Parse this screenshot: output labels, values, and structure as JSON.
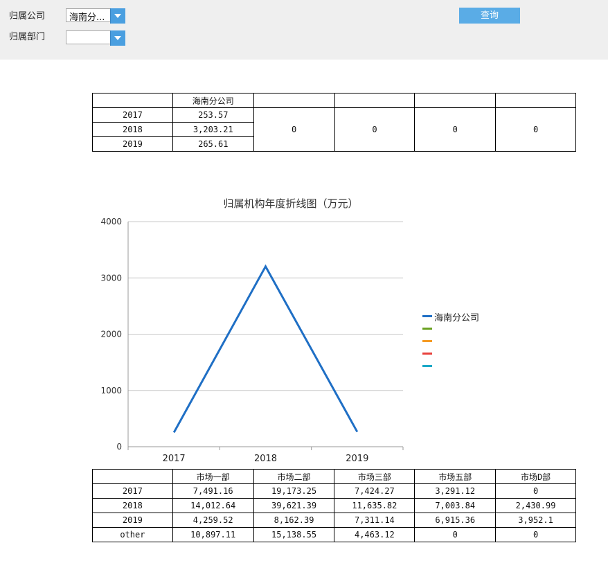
{
  "filters": {
    "company_label": "归属公司",
    "company_value": "海南分...",
    "dept_label": "归属部门",
    "dept_value": "",
    "query_label": "查询"
  },
  "top_table": {
    "headers": [
      "",
      "海南分公司",
      "",
      "",
      "",
      ""
    ],
    "rows": [
      {
        "year": "2017",
        "value": "253.57"
      },
      {
        "year": "2018",
        "value": "3,203.21"
      },
      {
        "year": "2019",
        "value": "265.61"
      }
    ],
    "merged_values": [
      "0",
      "0",
      "0",
      "0"
    ]
  },
  "chart_data": {
    "type": "line",
    "title": "归属机构年度折线图（万元）",
    "categories": [
      "2017",
      "2018",
      "2019"
    ],
    "ylim": [
      0,
      4000
    ],
    "yticks": [
      "0",
      "1000",
      "2000",
      "3000",
      "4000"
    ],
    "grid": true,
    "legend_position": "right",
    "series": [
      {
        "name": "海南分公司",
        "values": [
          253.57,
          3203.21,
          265.61
        ],
        "color": "#1f6fc5"
      },
      {
        "name": "",
        "values": [],
        "color": "#6aa121"
      },
      {
        "name": "",
        "values": [],
        "color": "#f59a23"
      },
      {
        "name": "",
        "values": [],
        "color": "#e8413c"
      },
      {
        "name": "",
        "values": [],
        "color": "#1ba8c7"
      }
    ]
  },
  "bottom_table": {
    "headers": [
      "",
      "市场一部",
      "市场二部",
      "市场三部",
      "市场五部",
      "市场D部"
    ],
    "rows": [
      [
        "2017",
        "7,491.16",
        "19,173.25",
        "7,424.27",
        "3,291.12",
        "0"
      ],
      [
        "2018",
        "14,012.64",
        "39,621.39",
        "11,635.82",
        "7,003.84",
        "2,430.99"
      ],
      [
        "2019",
        "4,259.52",
        "8,162.39",
        "7,311.14",
        "6,915.36",
        "3,952.1"
      ],
      [
        "other",
        "10,897.11",
        "15,138.55",
        "4,463.12",
        "0",
        "0"
      ]
    ]
  }
}
